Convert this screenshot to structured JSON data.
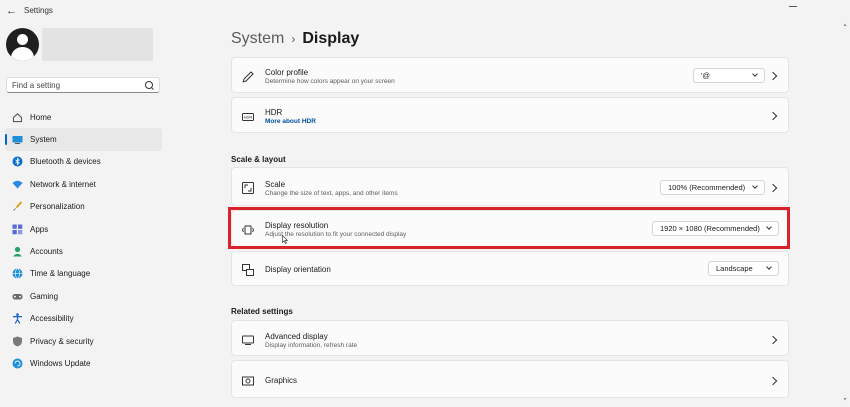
{
  "window": {
    "title": "Settings"
  },
  "search": {
    "placeholder": "Find a setting"
  },
  "sidebar": {
    "items": [
      {
        "label": "Home",
        "icon": "home-icon"
      },
      {
        "label": "System",
        "icon": "system-icon",
        "active": true
      },
      {
        "label": "Bluetooth & devices",
        "icon": "bluetooth-icon"
      },
      {
        "label": "Network & internet",
        "icon": "network-icon"
      },
      {
        "label": "Personalization",
        "icon": "brush-icon"
      },
      {
        "label": "Apps",
        "icon": "apps-icon"
      },
      {
        "label": "Accounts",
        "icon": "accounts-icon"
      },
      {
        "label": "Time & language",
        "icon": "globe-icon"
      },
      {
        "label": "Gaming",
        "icon": "gamepad-icon"
      },
      {
        "label": "Accessibility",
        "icon": "accessibility-icon"
      },
      {
        "label": "Privacy & security",
        "icon": "shield-icon"
      },
      {
        "label": "Windows Update",
        "icon": "update-icon"
      }
    ]
  },
  "breadcrumb": {
    "parent": "System",
    "separator": "›",
    "current": "Display"
  },
  "main": {
    "color_profile": {
      "title": "Color profile",
      "subtitle": "Determine how colors appear on your screen",
      "value": "'@"
    },
    "hdr": {
      "title": "HDR",
      "link": "More about HDR"
    },
    "section_scale": "Scale & layout",
    "scale": {
      "title": "Scale",
      "subtitle": "Change the size of text, apps, and other items",
      "value": "100% (Recommended)"
    },
    "resolution": {
      "title": "Display resolution",
      "subtitle": "Adjust the resolution to fit your connected display",
      "value": "1920 × 1080 (Recommended)"
    },
    "orientation": {
      "title": "Display orientation",
      "value": "Landscape"
    },
    "section_related": "Related settings",
    "advanced": {
      "title": "Advanced display",
      "subtitle": "Display information, refresh rate"
    },
    "graphics": {
      "title": "Graphics"
    }
  },
  "colors": {
    "accent": "#0067c0",
    "highlight": "#d8232a"
  }
}
